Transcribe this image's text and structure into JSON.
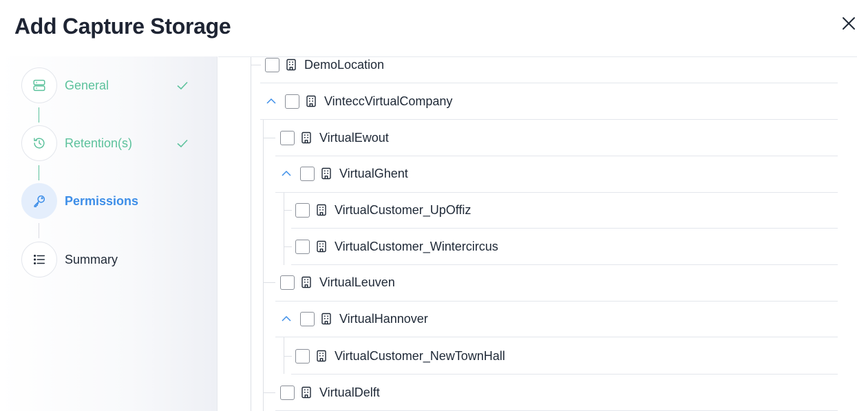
{
  "dialog": {
    "title": "Add Capture Storage"
  },
  "steps": [
    {
      "label": "General",
      "state": "done",
      "icon": "server-icon"
    },
    {
      "label": "Retention(s)",
      "state": "done",
      "icon": "history-icon"
    },
    {
      "label": "Permissions",
      "state": "active",
      "icon": "key-icon"
    },
    {
      "label": "Summary",
      "state": "pending",
      "icon": "list-icon"
    }
  ],
  "tree": {
    "nodes": [
      {
        "label": "DemoLocation",
        "level": 0,
        "expandable": false,
        "checked": false
      },
      {
        "label": "VinteccVirtualCompany",
        "level": 0,
        "expandable": true,
        "expanded": true,
        "checked": false
      },
      {
        "label": "VirtualEwout",
        "level": 1,
        "expandable": false,
        "checked": false
      },
      {
        "label": "VirtualGhent",
        "level": 1,
        "expandable": true,
        "expanded": true,
        "checked": false
      },
      {
        "label": "VirtualCustomer_UpOffiz",
        "level": 2,
        "expandable": false,
        "checked": false
      },
      {
        "label": "VirtualCustomer_Wintercircus",
        "level": 2,
        "expandable": false,
        "checked": false
      },
      {
        "label": "VirtualLeuven",
        "level": 1,
        "expandable": false,
        "checked": false
      },
      {
        "label": "VirtualHannover",
        "level": 1,
        "expandable": true,
        "expanded": true,
        "checked": false
      },
      {
        "label": "VirtualCustomer_NewTownHall",
        "level": 2,
        "expandable": false,
        "checked": false
      },
      {
        "label": "VirtualDelft",
        "level": 1,
        "expandable": false,
        "checked": false
      }
    ]
  },
  "colors": {
    "done": "#5cc29c",
    "active": "#3d8ee8",
    "active_bg": "#e4eefc",
    "chevron": "#3d8ee8"
  }
}
